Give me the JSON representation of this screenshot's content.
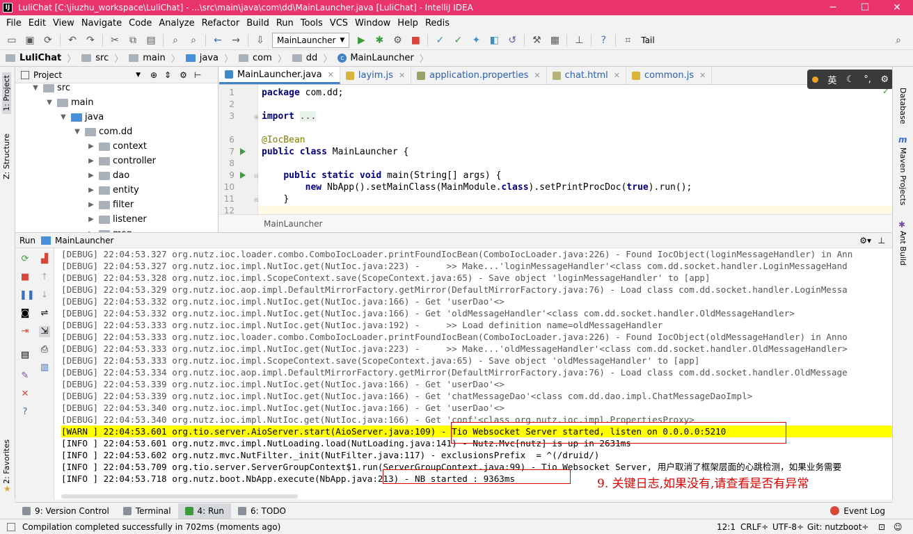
{
  "window": {
    "title": "LuliChat [C:\\jiuzhu_workspace\\LuliChat] - ...\\src\\main\\java\\com\\dd\\MainLauncher.java [LuliChat] - IntelliJ IDEA",
    "app_icon": "IJ",
    "controls": [
      "─",
      "☐",
      "✕"
    ]
  },
  "menu": [
    "File",
    "Edit",
    "View",
    "Navigate",
    "Code",
    "Analyze",
    "Refactor",
    "Build",
    "Run",
    "Tools",
    "VCS",
    "Window",
    "Help",
    "Redis"
  ],
  "toolbar": {
    "run_config": "MainLauncher",
    "tail_label": "Tail"
  },
  "breadcrumbs": [
    "LuliChat",
    "src",
    "main",
    "java",
    "com",
    "dd",
    "MainLauncher"
  ],
  "project": {
    "title": "Project",
    "tree": [
      {
        "label": "src",
        "depth": 1,
        "open": true
      },
      {
        "label": "main",
        "depth": 2,
        "open": true
      },
      {
        "label": "java",
        "depth": 3,
        "open": true
      },
      {
        "label": "com.dd",
        "depth": 4,
        "open": true
      },
      {
        "label": "context",
        "depth": 5,
        "open": false
      },
      {
        "label": "controller",
        "depth": 5,
        "open": false
      },
      {
        "label": "dao",
        "depth": 5,
        "open": false
      },
      {
        "label": "entity",
        "depth": 5,
        "open": false
      },
      {
        "label": "filter",
        "depth": 5,
        "open": false
      },
      {
        "label": "listener",
        "depth": 5,
        "open": false
      },
      {
        "label": "msg",
        "depth": 5,
        "open": false
      }
    ]
  },
  "left_strip": {
    "project": "1: Project",
    "structure": "Z: Structure",
    "favorites": "2: Favorites"
  },
  "right_strip": {
    "database": "Database",
    "maven": "Maven Projects",
    "ant": "Ant Build"
  },
  "editor": {
    "tabs": [
      {
        "label": "MainLauncher.java",
        "active": true,
        "color": "#3f8acb"
      },
      {
        "label": "layim.js",
        "active": false,
        "color": "#d9b33a"
      },
      {
        "label": "application.properties",
        "active": false,
        "color": "#9aa46a"
      },
      {
        "label": "chat.html",
        "active": false,
        "color": "#b9b27a"
      },
      {
        "label": "common.js",
        "active": false,
        "color": "#d9b33a"
      }
    ],
    "line_numbers": [
      "1",
      "2",
      "3",
      "6",
      "7",
      "8",
      "9",
      "10",
      "11",
      "12"
    ],
    "code_line1": "com.dd;",
    "code_import": "...",
    "code_annotation": "@IocBean",
    "code_class": "MainLauncher {",
    "code_main": "main(String[] args) {",
    "code_new": "NbApp().setMainClass(MainModule.",
    "code_new2": ").setPrintProcDoc(",
    "code_new3": ").run();",
    "code_close": "}",
    "kw_package": "package",
    "kw_import": "import",
    "kw_public": "public",
    "kw_class": "class",
    "kw_static": "static",
    "kw_void": "void",
    "kw_new": "new",
    "kw_classref": "class",
    "kw_true": "true",
    "crumb": "MainLauncher"
  },
  "ime": {
    "lang": "英",
    "moon": "☾",
    "dots": "°,",
    "gear": "⚙"
  },
  "run": {
    "header": "Run",
    "config": "MainLauncher",
    "lines": [
      {
        "level": "debug",
        "text": "[DEBUG] 22:04:53.327 org.nutz.ioc.loader.combo.ComboIocLoader.printFoundIocBean(ComboIocLoader.java:226) - Found IocObject(loginMessageHandler) in Ann"
      },
      {
        "level": "debug",
        "text": "[DEBUG] 22:04:53.327 org.nutz.ioc.impl.NutIoc.get(NutIoc.java:223) -     >> Make...'loginMessageHandler'<class com.dd.socket.handler.LoginMessageHand"
      },
      {
        "level": "debug",
        "text": "[DEBUG] 22:04:53.328 org.nutz.ioc.impl.ScopeContext.save(ScopeContext.java:65) - Save object 'loginMessageHandler' to [app]"
      },
      {
        "level": "debug",
        "text": "[DEBUG] 22:04:53.329 org.nutz.ioc.aop.impl.DefaultMirrorFactory.getMirror(DefaultMirrorFactory.java:76) - Load class com.dd.socket.handler.LoginMessa"
      },
      {
        "level": "debug",
        "text": "[DEBUG] 22:04:53.332 org.nutz.ioc.impl.NutIoc.get(NutIoc.java:166) - Get 'userDao'<>"
      },
      {
        "level": "debug",
        "text": "[DEBUG] 22:04:53.332 org.nutz.ioc.impl.NutIoc.get(NutIoc.java:166) - Get 'oldMessageHandler'<class com.dd.socket.handler.OldMessageHandler>"
      },
      {
        "level": "debug",
        "text": "[DEBUG] 22:04:53.333 org.nutz.ioc.impl.NutIoc.get(NutIoc.java:192) -     >> Load definition name=oldMessageHandler"
      },
      {
        "level": "debug",
        "text": "[DEBUG] 22:04:53.333 org.nutz.ioc.loader.combo.ComboIocLoader.printFoundIocBean(ComboIocLoader.java:226) - Found IocObject(oldMessageHandler) in Anno"
      },
      {
        "level": "debug",
        "text": "[DEBUG] 22:04:53.333 org.nutz.ioc.impl.NutIoc.get(NutIoc.java:223) -     >> Make...'oldMessageHandler'<class com.dd.socket.handler.OldMessageHandler>"
      },
      {
        "level": "debug",
        "text": "[DEBUG] 22:04:53.333 org.nutz.ioc.impl.ScopeContext.save(ScopeContext.java:65) - Save object 'oldMessageHandler' to [app]"
      },
      {
        "level": "debug",
        "text": "[DEBUG] 22:04:53.334 org.nutz.ioc.aop.impl.DefaultMirrorFactory.getMirror(DefaultMirrorFactory.java:76) - Load class com.dd.socket.handler.OldMessage"
      },
      {
        "level": "debug",
        "text": "[DEBUG] 22:04:53.339 org.nutz.ioc.impl.NutIoc.get(NutIoc.java:166) - Get 'userDao'<>"
      },
      {
        "level": "debug",
        "text": "[DEBUG] 22:04:53.339 org.nutz.ioc.impl.NutIoc.get(NutIoc.java:166) - Get 'chatMessageDao'<class com.dd.dao.impl.ChatMessageDaoImpl>"
      },
      {
        "level": "debug",
        "text": "[DEBUG] 22:04:53.340 org.nutz.ioc.impl.NutIoc.get(NutIoc.java:166) - Get 'userDao'<>"
      },
      {
        "level": "debug",
        "text": "[DEBUG] 22:04:53.340 org.nutz.ioc.impl.NutIoc.get(NutIoc.java:166) - Get 'conf'<class org.nutz.ioc.impl.PropertiesProxy>"
      },
      {
        "level": "warn",
        "text": "[WARN ] 22:04:53.601 org.tio.server.AioServer.start(AioServer.java:109) - Tio Websocket Server started, listen on 0.0.0.0:5210"
      },
      {
        "level": "info",
        "text": "[INFO ] 22:04:53.601 org.nutz.mvc.impl.NutLoading.load(NutLoading.java:141) - Nutz.Mvc[nutz] is up in 2631ms"
      },
      {
        "level": "info",
        "text": "[INFO ] 22:04:53.602 org.nutz.mvc.NutFilter._init(NutFilter.java:117) - exclusionsPrefix  = ^(/druid/)"
      },
      {
        "level": "info",
        "text": "[INFO ] 22:04:53.709 org.tio.server.ServerGroupContext$1.run(ServerGroupContext.java:99) - Tio Websocket Server, 用户取消了框架层面的心跳检测，如果业务需要"
      },
      {
        "level": "info",
        "text": "[INFO ] 22:04:53.718 org.nutz.boot.NbApp.execute(NbApp.java:213) - NB started : 9363ms"
      }
    ],
    "annotation": "9. 关键日志,如果没有,请查看是否有异常"
  },
  "bottom_tabs": [
    {
      "label": "9: Version Control",
      "active": false
    },
    {
      "label": "Terminal",
      "active": false
    },
    {
      "label": "4: Run",
      "active": true
    },
    {
      "label": "6: TODO",
      "active": false
    }
  ],
  "event_log": "Event Log",
  "status": {
    "message": "Compilation completed successfully in 702ms (moments ago)",
    "position": "12:1",
    "line_sep": "CRLF÷",
    "encoding": "UTF-8÷",
    "git": "Git: nutzboot÷"
  },
  "colors": {
    "title_bar": "#e8336d",
    "warn_bg": "#ffff00",
    "highlight_box": "#e00000",
    "annotation": "#e00000"
  }
}
